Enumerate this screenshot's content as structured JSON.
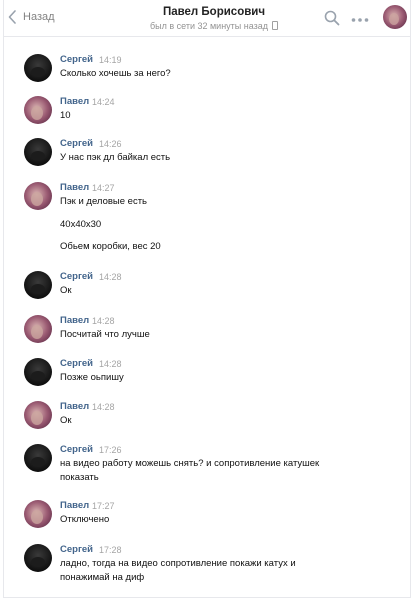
{
  "header": {
    "back_label": "Назад",
    "title": "Павел Борисович",
    "subtitle": "был в сети 32 минуты назад"
  },
  "colors": {
    "link": "#42648b",
    "muted": "#a5a5a5",
    "border": "#e7e8ec"
  },
  "icons": [
    "chevron-left-icon",
    "phone-icon",
    "search-icon",
    "more-icon"
  ],
  "messages": [
    {
      "author": "Сергей",
      "time": "14:19",
      "lines": [
        "Сколько хочешь за него?"
      ]
    },
    {
      "author": "Павел",
      "time": "14:24",
      "lines": [
        "10"
      ]
    },
    {
      "author": "Сергей",
      "time": "14:26",
      "lines": [
        "У нас пэк дл байкал есть"
      ]
    },
    {
      "author": "Павел",
      "time": "14:27",
      "lines": [
        "Пэк и деловые есть",
        "40х40х30",
        "Обьем коробки, вес 20"
      ]
    },
    {
      "author": "Сергей",
      "time": "14:28",
      "lines": [
        "Ок"
      ]
    },
    {
      "author": "Павел",
      "time": "14:28",
      "lines": [
        "Посчитай что лучше"
      ]
    },
    {
      "author": "Сергей",
      "time": "14:28",
      "lines": [
        "Позже оьпишу"
      ]
    },
    {
      "author": "Павел",
      "time": "14:28",
      "lines": [
        "Ок"
      ]
    },
    {
      "author": "Сергей",
      "time": "17:26",
      "lines": [
        "на видео работу можешь снять? и сопротивление катушек",
        "показать"
      ]
    },
    {
      "author": "Павел",
      "time": "17:27",
      "lines": [
        "Отключено"
      ]
    },
    {
      "author": "Сергей",
      "time": "17:28",
      "lines": [
        "ладно, тогда на видео сопротивление покажи катух и",
        "понажимай на диф"
      ]
    }
  ]
}
